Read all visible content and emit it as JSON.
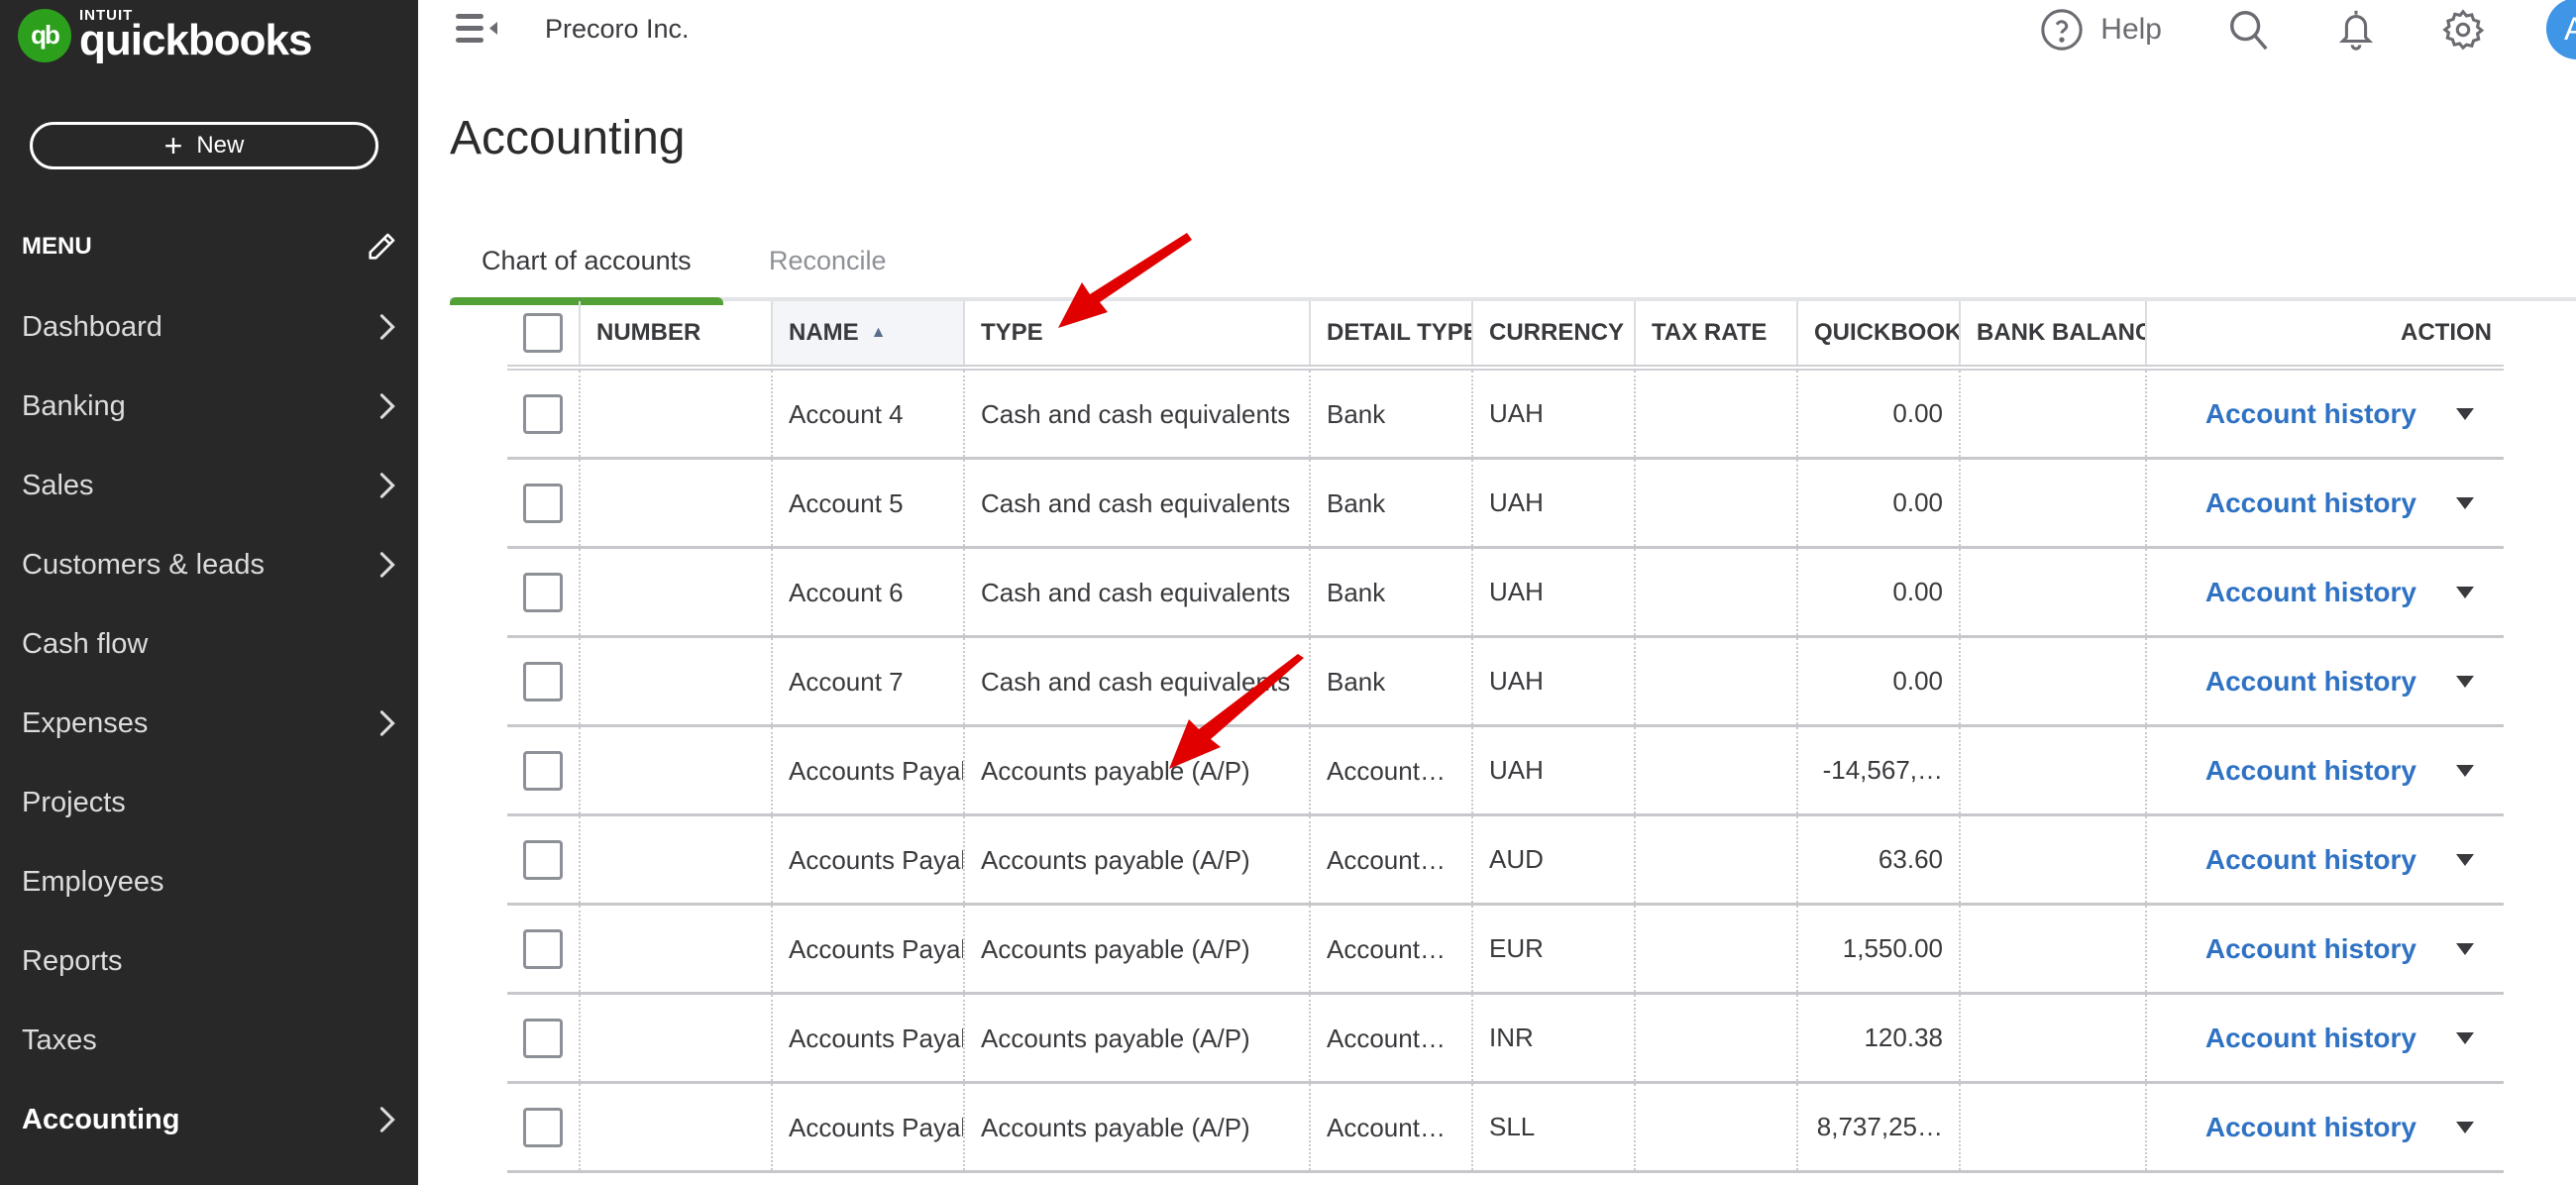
{
  "app": {
    "brand_small": "INTUIT",
    "brand": "quickbooks",
    "logo_mark": "qb",
    "company": "Precoro Inc.",
    "page_title": "Accounting"
  },
  "sidebar": {
    "new_label": "New",
    "menu_title": "MENU",
    "items": [
      {
        "label": "Dashboard",
        "chevron": true
      },
      {
        "label": "Banking",
        "chevron": true
      },
      {
        "label": "Sales",
        "chevron": true
      },
      {
        "label": "Customers & leads",
        "chevron": true
      },
      {
        "label": "Cash flow",
        "chevron": false
      },
      {
        "label": "Expenses",
        "chevron": true
      },
      {
        "label": "Projects",
        "chevron": false
      },
      {
        "label": "Employees",
        "chevron": false
      },
      {
        "label": "Reports",
        "chevron": false
      },
      {
        "label": "Taxes",
        "chevron": false
      },
      {
        "label": "Accounting",
        "chevron": true,
        "active": true
      }
    ]
  },
  "topbar": {
    "help_label": "Help",
    "avatar_initial": "A",
    "icons": [
      "help-icon",
      "search-icon",
      "bell-icon",
      "gear-icon"
    ]
  },
  "tabs": [
    {
      "label": "Chart of accounts",
      "active": true
    },
    {
      "label": "Reconcile",
      "active": false
    }
  ],
  "table": {
    "columns": [
      "NUMBER",
      "NAME",
      "TYPE",
      "DETAIL TYPE",
      "CURRENCY",
      "TAX RATE",
      "QUICKBOOKS BALANCE",
      "BANK BALANCE",
      "ACTION"
    ],
    "sorted_column": "NAME",
    "sort_direction": "ascending",
    "rows": [
      {
        "number": "",
        "name": "Account 4",
        "type": "Cash and cash equivalents",
        "detail_type": "Bank",
        "currency": "UAH",
        "tax_rate": "",
        "qb_balance": "0.00",
        "bank_balance": "",
        "action": "Account history"
      },
      {
        "number": "",
        "name": "Account 5",
        "type": "Cash and cash equivalents",
        "detail_type": "Bank",
        "currency": "UAH",
        "tax_rate": "",
        "qb_balance": "0.00",
        "bank_balance": "",
        "action": "Account history"
      },
      {
        "number": "",
        "name": "Account 6",
        "type": "Cash and cash equivalents",
        "detail_type": "Bank",
        "currency": "UAH",
        "tax_rate": "",
        "qb_balance": "0.00",
        "bank_balance": "",
        "action": "Account history"
      },
      {
        "number": "",
        "name": "Account 7",
        "type": "Cash and cash equivalents",
        "detail_type": "Bank",
        "currency": "UAH",
        "tax_rate": "",
        "qb_balance": "0.00",
        "bank_balance": "",
        "action": "Account history"
      },
      {
        "number": "",
        "name": "Accounts Payable",
        "type": "Accounts payable (A/P)",
        "detail_type": "Account…",
        "currency": "UAH",
        "tax_rate": "",
        "qb_balance": "-14,567,…",
        "bank_balance": "",
        "action": "Account history"
      },
      {
        "number": "",
        "name": "Accounts Payable",
        "type": "Accounts payable (A/P)",
        "detail_type": "Account…",
        "currency": "AUD",
        "tax_rate": "",
        "qb_balance": "63.60",
        "bank_balance": "",
        "action": "Account history"
      },
      {
        "number": "",
        "name": "Accounts Payable",
        "type": "Accounts payable (A/P)",
        "detail_type": "Account…",
        "currency": "EUR",
        "tax_rate": "",
        "qb_balance": "1,550.00",
        "bank_balance": "",
        "action": "Account history"
      },
      {
        "number": "",
        "name": "Accounts Payable",
        "type": "Accounts payable (A/P)",
        "detail_type": "Account…",
        "currency": "INR",
        "tax_rate": "",
        "qb_balance": "120.38",
        "bank_balance": "",
        "action": "Account history"
      },
      {
        "number": "",
        "name": "Accounts Payable",
        "type": "Accounts payable (A/P)",
        "detail_type": "Account…",
        "currency": "SLL",
        "tax_rate": "",
        "qb_balance": "8,737,25…",
        "bank_balance": "",
        "action": "Account history"
      }
    ]
  },
  "colors": {
    "sidebar_bg": "#282828",
    "brand_green": "#2ca01c",
    "tab_active": "#53a037",
    "link_blue": "#2f72c4",
    "avatar_blue": "#3f95e6",
    "annotation_red": "#e00000"
  }
}
